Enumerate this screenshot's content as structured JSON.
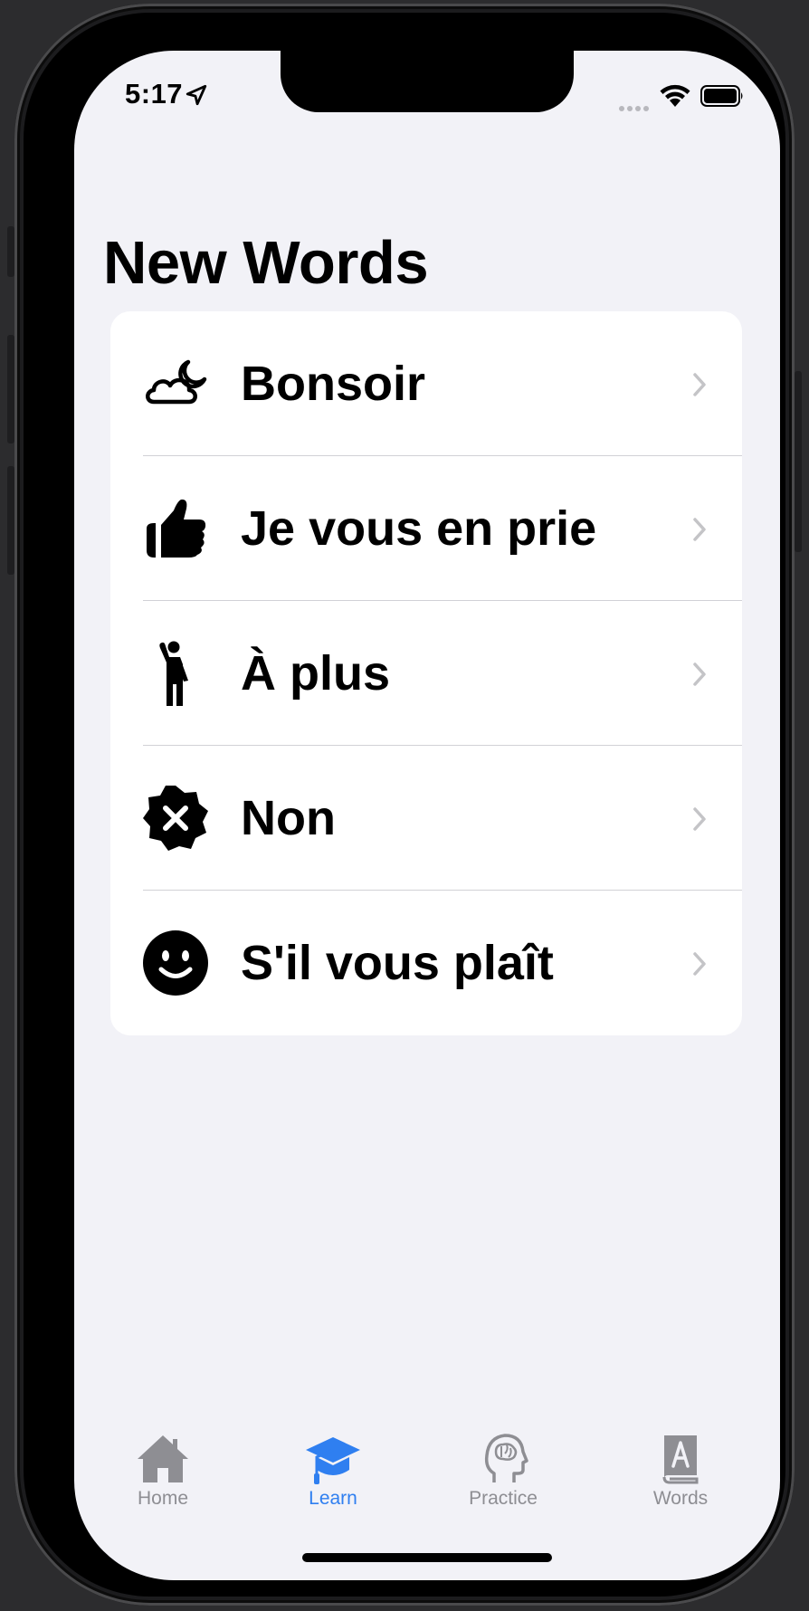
{
  "status_bar": {
    "time": "5:17",
    "icons": [
      "location-arrow-icon",
      "cellular-dots-icon",
      "wifi-icon",
      "battery-icon"
    ]
  },
  "page": {
    "title": "New Words"
  },
  "words": [
    {
      "label": "Bonsoir",
      "icon": "cloud-moon-icon"
    },
    {
      "label": "Je vous en prie",
      "icon": "thumbs-up-icon"
    },
    {
      "label": "À plus",
      "icon": "person-waving-icon"
    },
    {
      "label": "Non",
      "icon": "xmark-seal-icon"
    },
    {
      "label": "S'il vous plaît",
      "icon": "smiley-face-icon"
    }
  ],
  "tab_bar": {
    "tabs": [
      {
        "label": "Home",
        "icon": "house-icon",
        "active": false
      },
      {
        "label": "Learn",
        "icon": "graduation-cap-icon",
        "active": true
      },
      {
        "label": "Practice",
        "icon": "head-brain-icon",
        "active": false
      },
      {
        "label": "Words",
        "icon": "dictionary-book-icon",
        "active": false
      }
    ]
  },
  "colors": {
    "accent": "#2f7ff0",
    "inactive_tab": "#8e8e93",
    "background": "#f2f2f7",
    "card": "#ffffff",
    "separator": "#d1d1d6"
  }
}
